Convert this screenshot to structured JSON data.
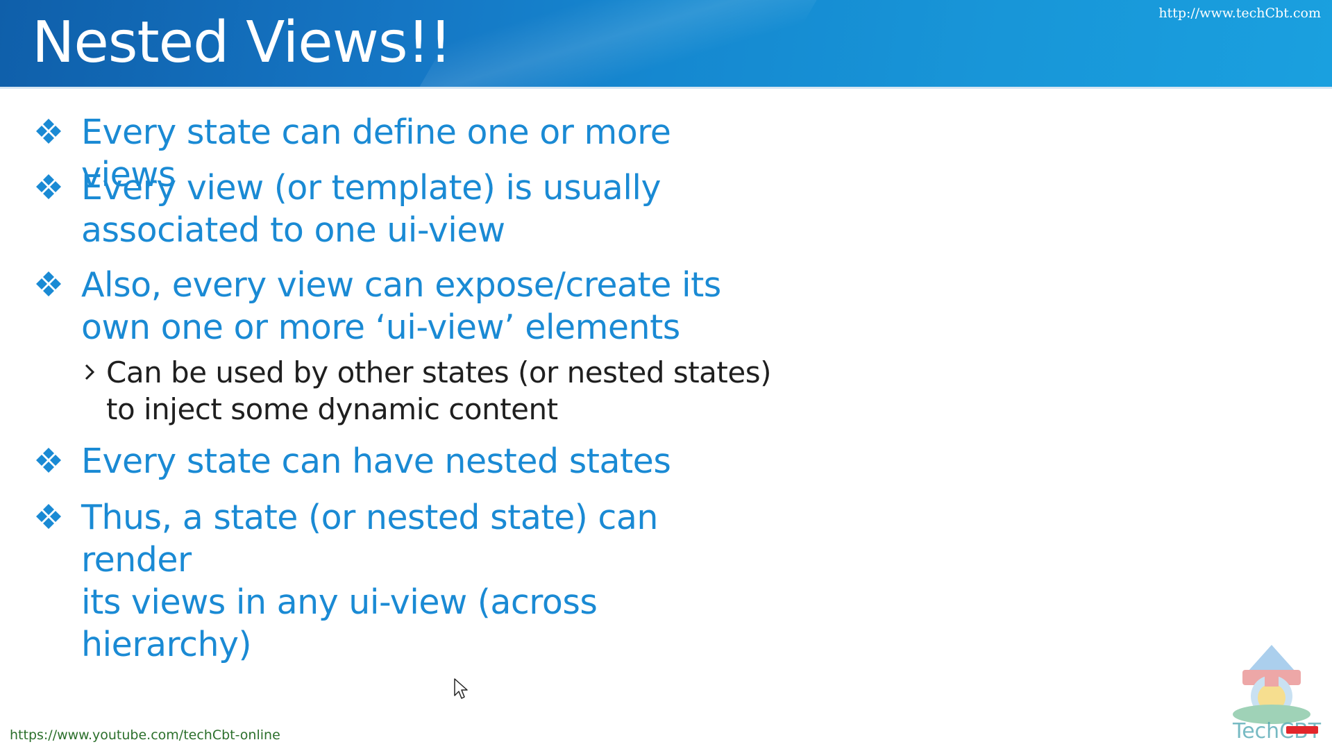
{
  "header": {
    "title": "Nested Views!!",
    "url": "http://www.techCbt.com"
  },
  "bullets": [
    {
      "lines": [
        "Every state can define one or more views"
      ]
    },
    {
      "lines": [
        "Every view (or template) is usually",
        "associated to one ui-view"
      ]
    },
    {
      "lines": [
        "Also, every view can expose/create its",
        "own one or more ‘ui-view’ elements"
      ],
      "sub": [
        "Can be used by other states (or nested states)",
        "to inject some dynamic content"
      ]
    },
    {
      "lines": [
        "Every state can have nested states"
      ]
    },
    {
      "lines": [
        "Thus, a state (or nested state) can render",
        "its views in any ui-view (across hierarchy)"
      ]
    }
  ],
  "footer": {
    "url": "https://www.youtube.com/techCbt-online"
  },
  "logo": {
    "text": "TechCBT",
    "icon": "techcbt-logo-icon"
  },
  "icons": {
    "bullet": "diamond-cluster-bullet-icon",
    "sub_bullet": "chevron-right-icon",
    "cursor": "mouse-pointer-icon",
    "badge": "youtube-subscribe-badge-icon"
  },
  "colors": {
    "header_gradient_start": "#0f5faa",
    "header_gradient_end": "#1aa0df",
    "bullet_text": "#1a8ad4",
    "sub_text": "#1f1f1f",
    "footer_url": "#2b6f2b"
  }
}
